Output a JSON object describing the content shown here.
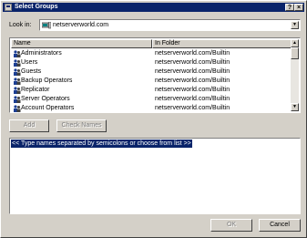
{
  "window": {
    "title": "Select Groups",
    "help_glyph": "?",
    "close_glyph": "×"
  },
  "lookin": {
    "label": "Look in:",
    "value": "netserverworld.com",
    "icon": "domain-icon"
  },
  "list": {
    "columns": [
      "Name",
      "In Folder"
    ],
    "rows": [
      {
        "name": "Administrators",
        "folder": "netserverworld.com/Builtin"
      },
      {
        "name": "Users",
        "folder": "netserverworld.com/Builtin"
      },
      {
        "name": "Guests",
        "folder": "netserverworld.com/Builtin"
      },
      {
        "name": "Backup Operators",
        "folder": "netserverworld.com/Builtin"
      },
      {
        "name": "Replicator",
        "folder": "netserverworld.com/Builtin"
      },
      {
        "name": "Server Operators",
        "folder": "netserverworld.com/Builtin"
      },
      {
        "name": "Account Operators",
        "folder": "netserverworld.com/Builtin"
      }
    ],
    "row_icon": "group-icon"
  },
  "buttons": {
    "add": "Add",
    "check_names": "Check Names",
    "ok": "OK",
    "cancel": "Cancel"
  },
  "names_box": {
    "hint": "<< Type names separated by semicolons or choose from list >>"
  },
  "colors": {
    "titlebar": "#0a246a",
    "face": "#d4d0c8",
    "selection": "#0a246a"
  }
}
